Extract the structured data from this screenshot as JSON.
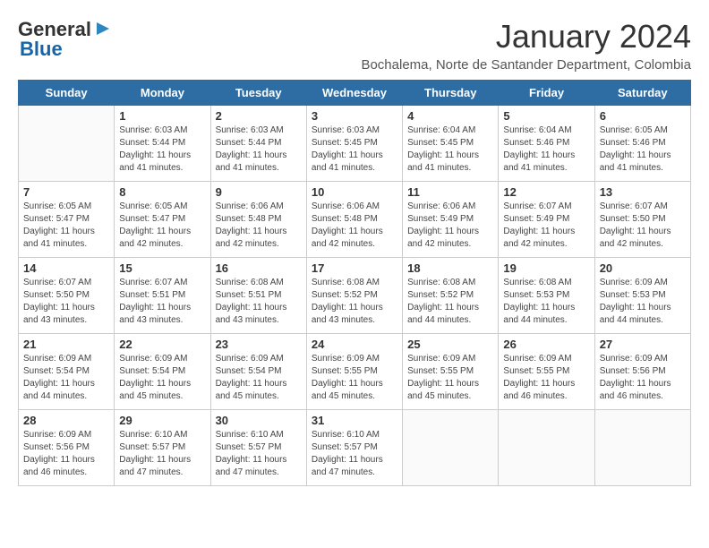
{
  "header": {
    "logo_general": "General",
    "logo_blue": "Blue",
    "title": "January 2024",
    "subtitle": "Bochalema, Norte de Santander Department, Colombia"
  },
  "weekdays": [
    "Sunday",
    "Monday",
    "Tuesday",
    "Wednesday",
    "Thursday",
    "Friday",
    "Saturday"
  ],
  "weeks": [
    [
      {
        "day": "",
        "sunrise": "",
        "sunset": "",
        "daylight": ""
      },
      {
        "day": "1",
        "sunrise": "Sunrise: 6:03 AM",
        "sunset": "Sunset: 5:44 PM",
        "daylight": "Daylight: 11 hours and 41 minutes."
      },
      {
        "day": "2",
        "sunrise": "Sunrise: 6:03 AM",
        "sunset": "Sunset: 5:44 PM",
        "daylight": "Daylight: 11 hours and 41 minutes."
      },
      {
        "day": "3",
        "sunrise": "Sunrise: 6:03 AM",
        "sunset": "Sunset: 5:45 PM",
        "daylight": "Daylight: 11 hours and 41 minutes."
      },
      {
        "day": "4",
        "sunrise": "Sunrise: 6:04 AM",
        "sunset": "Sunset: 5:45 PM",
        "daylight": "Daylight: 11 hours and 41 minutes."
      },
      {
        "day": "5",
        "sunrise": "Sunrise: 6:04 AM",
        "sunset": "Sunset: 5:46 PM",
        "daylight": "Daylight: 11 hours and 41 minutes."
      },
      {
        "day": "6",
        "sunrise": "Sunrise: 6:05 AM",
        "sunset": "Sunset: 5:46 PM",
        "daylight": "Daylight: 11 hours and 41 minutes."
      }
    ],
    [
      {
        "day": "7",
        "sunrise": "Sunrise: 6:05 AM",
        "sunset": "Sunset: 5:47 PM",
        "daylight": "Daylight: 11 hours and 41 minutes."
      },
      {
        "day": "8",
        "sunrise": "Sunrise: 6:05 AM",
        "sunset": "Sunset: 5:47 PM",
        "daylight": "Daylight: 11 hours and 42 minutes."
      },
      {
        "day": "9",
        "sunrise": "Sunrise: 6:06 AM",
        "sunset": "Sunset: 5:48 PM",
        "daylight": "Daylight: 11 hours and 42 minutes."
      },
      {
        "day": "10",
        "sunrise": "Sunrise: 6:06 AM",
        "sunset": "Sunset: 5:48 PM",
        "daylight": "Daylight: 11 hours and 42 minutes."
      },
      {
        "day": "11",
        "sunrise": "Sunrise: 6:06 AM",
        "sunset": "Sunset: 5:49 PM",
        "daylight": "Daylight: 11 hours and 42 minutes."
      },
      {
        "day": "12",
        "sunrise": "Sunrise: 6:07 AM",
        "sunset": "Sunset: 5:49 PM",
        "daylight": "Daylight: 11 hours and 42 minutes."
      },
      {
        "day": "13",
        "sunrise": "Sunrise: 6:07 AM",
        "sunset": "Sunset: 5:50 PM",
        "daylight": "Daylight: 11 hours and 42 minutes."
      }
    ],
    [
      {
        "day": "14",
        "sunrise": "Sunrise: 6:07 AM",
        "sunset": "Sunset: 5:50 PM",
        "daylight": "Daylight: 11 hours and 43 minutes."
      },
      {
        "day": "15",
        "sunrise": "Sunrise: 6:07 AM",
        "sunset": "Sunset: 5:51 PM",
        "daylight": "Daylight: 11 hours and 43 minutes."
      },
      {
        "day": "16",
        "sunrise": "Sunrise: 6:08 AM",
        "sunset": "Sunset: 5:51 PM",
        "daylight": "Daylight: 11 hours and 43 minutes."
      },
      {
        "day": "17",
        "sunrise": "Sunrise: 6:08 AM",
        "sunset": "Sunset: 5:52 PM",
        "daylight": "Daylight: 11 hours and 43 minutes."
      },
      {
        "day": "18",
        "sunrise": "Sunrise: 6:08 AM",
        "sunset": "Sunset: 5:52 PM",
        "daylight": "Daylight: 11 hours and 44 minutes."
      },
      {
        "day": "19",
        "sunrise": "Sunrise: 6:08 AM",
        "sunset": "Sunset: 5:53 PM",
        "daylight": "Daylight: 11 hours and 44 minutes."
      },
      {
        "day": "20",
        "sunrise": "Sunrise: 6:09 AM",
        "sunset": "Sunset: 5:53 PM",
        "daylight": "Daylight: 11 hours and 44 minutes."
      }
    ],
    [
      {
        "day": "21",
        "sunrise": "Sunrise: 6:09 AM",
        "sunset": "Sunset: 5:54 PM",
        "daylight": "Daylight: 11 hours and 44 minutes."
      },
      {
        "day": "22",
        "sunrise": "Sunrise: 6:09 AM",
        "sunset": "Sunset: 5:54 PM",
        "daylight": "Daylight: 11 hours and 45 minutes."
      },
      {
        "day": "23",
        "sunrise": "Sunrise: 6:09 AM",
        "sunset": "Sunset: 5:54 PM",
        "daylight": "Daylight: 11 hours and 45 minutes."
      },
      {
        "day": "24",
        "sunrise": "Sunrise: 6:09 AM",
        "sunset": "Sunset: 5:55 PM",
        "daylight": "Daylight: 11 hours and 45 minutes."
      },
      {
        "day": "25",
        "sunrise": "Sunrise: 6:09 AM",
        "sunset": "Sunset: 5:55 PM",
        "daylight": "Daylight: 11 hours and 45 minutes."
      },
      {
        "day": "26",
        "sunrise": "Sunrise: 6:09 AM",
        "sunset": "Sunset: 5:55 PM",
        "daylight": "Daylight: 11 hours and 46 minutes."
      },
      {
        "day": "27",
        "sunrise": "Sunrise: 6:09 AM",
        "sunset": "Sunset: 5:56 PM",
        "daylight": "Daylight: 11 hours and 46 minutes."
      }
    ],
    [
      {
        "day": "28",
        "sunrise": "Sunrise: 6:09 AM",
        "sunset": "Sunset: 5:56 PM",
        "daylight": "Daylight: 11 hours and 46 minutes."
      },
      {
        "day": "29",
        "sunrise": "Sunrise: 6:10 AM",
        "sunset": "Sunset: 5:57 PM",
        "daylight": "Daylight: 11 hours and 47 minutes."
      },
      {
        "day": "30",
        "sunrise": "Sunrise: 6:10 AM",
        "sunset": "Sunset: 5:57 PM",
        "daylight": "Daylight: 11 hours and 47 minutes."
      },
      {
        "day": "31",
        "sunrise": "Sunrise: 6:10 AM",
        "sunset": "Sunset: 5:57 PM",
        "daylight": "Daylight: 11 hours and 47 minutes."
      },
      {
        "day": "",
        "sunrise": "",
        "sunset": "",
        "daylight": ""
      },
      {
        "day": "",
        "sunrise": "",
        "sunset": "",
        "daylight": ""
      },
      {
        "day": "",
        "sunrise": "",
        "sunset": "",
        "daylight": ""
      }
    ]
  ]
}
